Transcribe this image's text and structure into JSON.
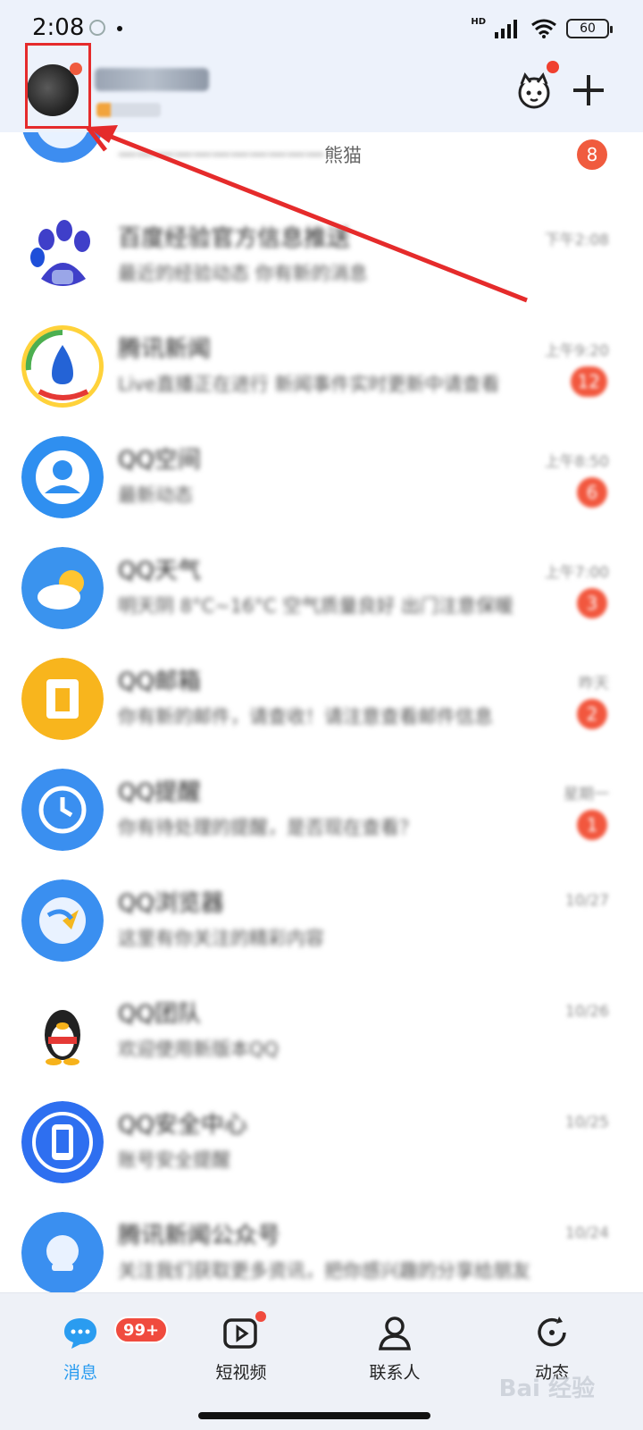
{
  "status_bar": {
    "time": "2:08",
    "battery": "60",
    "network": "HD"
  },
  "header": {
    "nickname": "",
    "accent_color": "#e52b2b"
  },
  "conversations": [
    {
      "id": "first",
      "name": "",
      "message_clear": "熊猫",
      "message_prefix": "",
      "badge": "8",
      "time": ""
    },
    {
      "id": "c2",
      "name": "",
      "message": "",
      "time": "",
      "badge": "",
      "avatar": "paw-icon"
    },
    {
      "id": "c3",
      "name": "",
      "message": "",
      "time": "",
      "badge": "",
      "avatar": "mic-icon"
    },
    {
      "id": "c4",
      "name": "",
      "message": "",
      "time": "",
      "badge": "",
      "avatar": "person-icon"
    },
    {
      "id": "c5",
      "name": "",
      "message": "",
      "time": "",
      "badge": "",
      "avatar": "weather-icon"
    },
    {
      "id": "c6",
      "name": "",
      "message": "",
      "time": "",
      "badge": "",
      "avatar": "notebook-icon"
    },
    {
      "id": "c7",
      "name": "",
      "message": "",
      "time": "",
      "badge": "",
      "avatar": "clock-icon"
    },
    {
      "id": "c8",
      "name": "",
      "message": "",
      "time": "",
      "badge": "",
      "avatar": "globe-icon"
    },
    {
      "id": "c9",
      "name": "",
      "message": "",
      "time": "",
      "badge": "",
      "avatar": "penguin-icon"
    },
    {
      "id": "c10",
      "name": "",
      "message": "",
      "time": "",
      "badge": "",
      "avatar": "phone-icon"
    },
    {
      "id": "c11",
      "name": "",
      "message": "",
      "time": "",
      "badge": "",
      "avatar": "shield-icon"
    }
  ],
  "tabbar": {
    "messages": {
      "label": "消息",
      "badge": "99+"
    },
    "videos": {
      "label": "短视频"
    },
    "contacts": {
      "label": "联系人"
    },
    "moments": {
      "label": "动态"
    }
  },
  "watermark": "Bai 经验",
  "colors": {
    "active_tab": "#2a9cf0",
    "badge_red": "#f05b3e",
    "header_bg": "#edf2fb"
  }
}
